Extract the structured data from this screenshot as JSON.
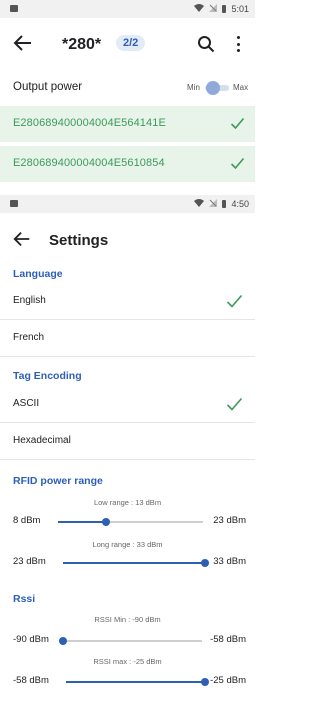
{
  "screen1": {
    "status": {
      "time": "5:01"
    },
    "appbar": {
      "title": "*280*",
      "count": "2/2"
    },
    "output_power": {
      "label": "Output power",
      "min_label": "Min",
      "max_label": "Max"
    },
    "tags": [
      {
        "epc": "E280689400004004E564141E"
      },
      {
        "epc": "E280689400004004E5610854"
      }
    ]
  },
  "screen2": {
    "status": {
      "time": "4:50"
    },
    "appbar": {
      "title": "Settings"
    },
    "language": {
      "header": "Language",
      "options": [
        {
          "label": "English",
          "selected": true
        },
        {
          "label": "French",
          "selected": false
        }
      ]
    },
    "tag_encoding": {
      "header": "Tag Encoding",
      "options": [
        {
          "label": "ASCII",
          "selected": true
        },
        {
          "label": "Hexadecimal",
          "selected": false
        }
      ]
    },
    "rfid_power_range": {
      "header": "RFID power range",
      "low": {
        "caption": "Low range : 13 dBm",
        "min_label": "8 dBm",
        "max_label": "23 dBm",
        "min": 8,
        "max": 23,
        "value": 13
      },
      "long": {
        "caption": "Long range : 33 dBm",
        "min_label": "23 dBm",
        "max_label": "33 dBm",
        "min": 23,
        "max": 33,
        "value": 33
      }
    },
    "rssi": {
      "header": "Rssi",
      "min": {
        "caption": "RSSI Min : -90 dBm",
        "min_label": "-90 dBm",
        "max_label": "-58 dBm",
        "min": -90,
        "max": -58,
        "value": -90
      },
      "max": {
        "caption": "RSSI max : -25 dBm",
        "min_label": "-58 dBm",
        "max_label": "-25 dBm",
        "min": -58,
        "max": -25,
        "value": -25
      }
    }
  },
  "colors": {
    "accent": "#2d5fb5",
    "success": "#3b9a5a",
    "tag_row_bg": "#e8f4ea"
  },
  "icons": {
    "back": "arrow-left-icon",
    "search": "search-icon",
    "more": "more-vert-icon",
    "check": "check-icon",
    "wifi": "wifi-icon",
    "signal": "signal-icon",
    "battery": "battery-icon"
  }
}
